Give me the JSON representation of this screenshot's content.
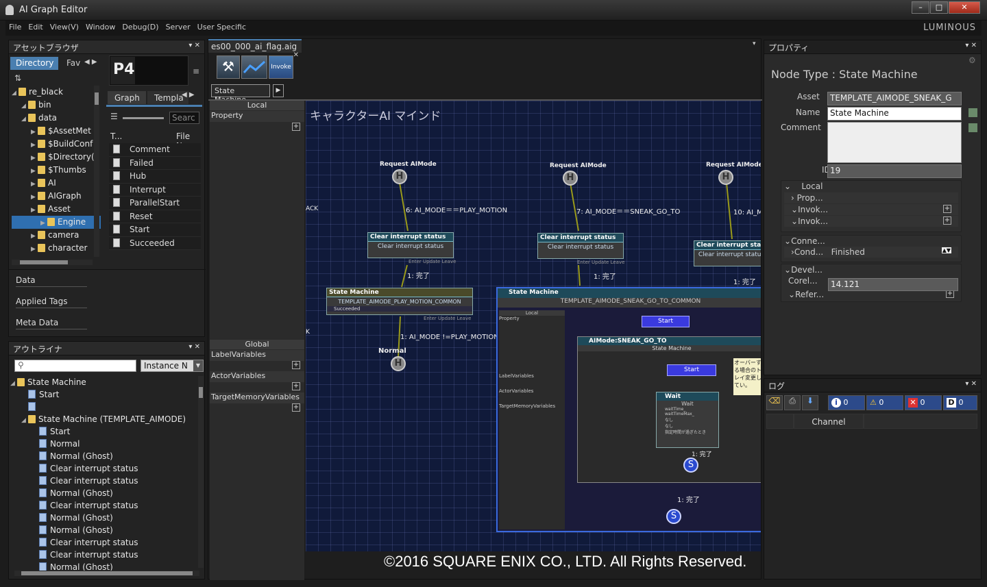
{
  "app": {
    "title": "AI Graph Editor",
    "brand": "LUMINOUS"
  },
  "window_buttons": {
    "minimize": "–",
    "maximize": "□",
    "close": "✕"
  },
  "menu": [
    "File",
    "Edit",
    "View(V)",
    "Window",
    "Debug(D)",
    "Server",
    "User Specific"
  ],
  "asset_browser": {
    "title": "アセットブラウザ",
    "tabs": [
      "Directory",
      "Fav"
    ],
    "tree": [
      {
        "label": "re_black",
        "indent": 0
      },
      {
        "label": "bin",
        "indent": 1
      },
      {
        "label": "data",
        "indent": 1
      },
      {
        "label": "$AssetMet",
        "indent": 2
      },
      {
        "label": "$BuildConf",
        "indent": 2
      },
      {
        "label": "$Directory(",
        "indent": 2
      },
      {
        "label": "$Thumbs",
        "indent": 2
      },
      {
        "label": "AI",
        "indent": 2
      },
      {
        "label": "AIGraph",
        "indent": 2
      },
      {
        "label": "Asset",
        "indent": 2
      },
      {
        "label": "Engine",
        "indent": 3
      },
      {
        "label": "camera",
        "indent": 2
      },
      {
        "label": "character",
        "indent": 2
      }
    ],
    "side_tabs": [
      "Graph",
      "Templa"
    ],
    "search_placeholder": "Searc",
    "columns": [
      "T...",
      "File Na"
    ],
    "files": [
      "Comment",
      "Failed",
      "Hub",
      "Interrupt",
      "ParallelStart",
      "Reset",
      "Start",
      "Succeeded"
    ],
    "bottom_items": [
      "Data",
      "Applied Tags",
      "Meta Data"
    ]
  },
  "outliner": {
    "title": "アウトライナ",
    "filter": "Instance N",
    "items": [
      {
        "label": "State Machine",
        "indent": 0,
        "type": "folder"
      },
      {
        "label": "Start",
        "indent": 1,
        "type": "node"
      },
      {
        "label": "",
        "indent": 1,
        "type": "node"
      },
      {
        "label": "State Machine (TEMPLATE_AIMODE)",
        "indent": 1,
        "type": "folder"
      },
      {
        "label": "Start",
        "indent": 2,
        "type": "node"
      },
      {
        "label": "Normal",
        "indent": 2,
        "type": "node"
      },
      {
        "label": "Normal (Ghost)",
        "indent": 2,
        "type": "node"
      },
      {
        "label": "Clear interrupt status",
        "indent": 2,
        "type": "node"
      },
      {
        "label": "Clear interrupt status",
        "indent": 2,
        "type": "node"
      },
      {
        "label": "Normal (Ghost)",
        "indent": 2,
        "type": "node"
      },
      {
        "label": "Clear interrupt status",
        "indent": 2,
        "type": "node"
      },
      {
        "label": "Normal (Ghost)",
        "indent": 2,
        "type": "node"
      },
      {
        "label": "Normal (Ghost)",
        "indent": 2,
        "type": "node"
      },
      {
        "label": "Clear interrupt status",
        "indent": 2,
        "type": "node"
      },
      {
        "label": "Clear interrupt status",
        "indent": 2,
        "type": "node"
      },
      {
        "label": "Normal (Ghost)",
        "indent": 2,
        "type": "node"
      }
    ]
  },
  "editor": {
    "tab": "es00_000_ai_flag.aig",
    "toolbar_invoke": "Invoke",
    "breadcrumb": "State Machine",
    "local_header": "Local",
    "property_label": "Property",
    "global_header": "Global",
    "global_vars": [
      "LabelVariables",
      "ActorVariables",
      "TargetMemoryVariables"
    ],
    "graph_title": "キャラクターAI マインド",
    "nodes": {
      "request1": "Request AIMode",
      "request2": "Request AIMode",
      "request3": "Request AIMode",
      "edge1": "6: AI_MODE＝＝PLAY_MOTION",
      "edge2": "7: AI_MODE＝＝SNEAK_GO_TO",
      "edge3": "10: AI_M",
      "clear_title": "Clear interrupt status",
      "clear_body": "Clear interrupt status",
      "ports": "Enter Update Leave",
      "done": "1: 完了",
      "sm_title": "State Machine",
      "sm_template": "TEMPLATE_AIMODE_PLAY_MOTION_COMMON",
      "sm_succeeded": "Succeeded",
      "edge_back": "1: AI_MODE !=PLAY_MOTION",
      "normal": "Normal",
      "left_cut1": "ACK",
      "left_cut2": "K",
      "sm2_template": "TEMPLATE_AIMODE_SNEAK_GO_TO_COMMON",
      "start": "Start",
      "inner_sm_title": "AIMode:SNEAK_GO_TO",
      "inner_sm_body": "State Machine",
      "wait_title": "Wait",
      "wait_body": "Wait",
      "wait_params": [
        "waitTime_",
        "waitTimeMax_",
        "なし",
        "なし",
        "指定時間が過ぎたとき"
      ],
      "sticky": "オーバーする場合のトレイ変更してい。",
      "s": "S",
      "h": "H",
      "enter": "Enter",
      "ports_full": "Enter Update Leave"
    },
    "copyright": "©2016 SQUARE ENIX CO., LTD. All Rights Reserved."
  },
  "properties": {
    "title": "プロパティ",
    "node_type": "Node Type : State Machine",
    "asset_label": "Asset",
    "asset_value": "TEMPLATE_AIMODE_SNEAK_G",
    "name_label": "Name",
    "name_value": "State Machine",
    "comment_label": "Comment",
    "id_label": "ID",
    "id_value": "19",
    "local": "Local",
    "prop": "Prop...",
    "invok1": "Invok...",
    "invok2": "Invok...",
    "conne": "Conne...",
    "cond": "Cond...",
    "finished": "Finished",
    "devel": "Devel...",
    "corel": "Corel...",
    "corel_value": "14.121",
    "refer": "Refer..."
  },
  "log": {
    "title": "ログ",
    "counts": {
      "info": "0",
      "warn": "0",
      "error": "0",
      "debug": "0"
    },
    "d_label": "D",
    "channel": "Channel"
  }
}
